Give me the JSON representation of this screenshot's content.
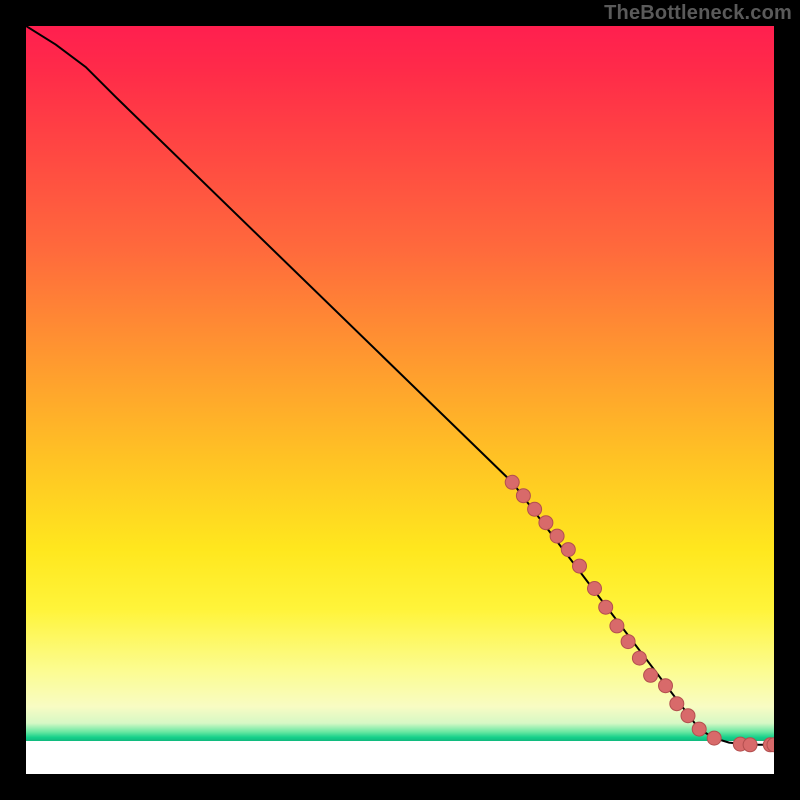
{
  "watermark": "TheBottleneck.com",
  "colors": {
    "frame": "#000000",
    "watermark_text": "#5a5a5a",
    "curve_stroke": "#000000",
    "marker_fill": "#d86a6a",
    "marker_stroke": "#b34f4f",
    "gradient_top": "#ff1f4f",
    "gradient_green": "#16d08b",
    "gradient_bottom": "#ffffff"
  },
  "chart_data": {
    "type": "line",
    "title": "",
    "xlabel": "",
    "ylabel": "",
    "xlim": [
      0,
      100
    ],
    "ylim": [
      0,
      100
    ],
    "grid": false,
    "legend": false,
    "curve": [
      {
        "x": 0,
        "y": 100
      },
      {
        "x": 4,
        "y": 97.5
      },
      {
        "x": 8,
        "y": 94.5
      },
      {
        "x": 12,
        "y": 90.5
      },
      {
        "x": 65,
        "y": 39
      },
      {
        "x": 90,
        "y": 6
      },
      {
        "x": 92,
        "y": 4.8
      },
      {
        "x": 94,
        "y": 4.2
      },
      {
        "x": 96,
        "y": 4.0
      },
      {
        "x": 98,
        "y": 3.9
      },
      {
        "x": 100,
        "y": 3.9
      }
    ],
    "markers": [
      {
        "x": 65.0,
        "y": 39.0
      },
      {
        "x": 66.5,
        "y": 37.2
      },
      {
        "x": 68.0,
        "y": 35.4
      },
      {
        "x": 69.5,
        "y": 33.6
      },
      {
        "x": 71.0,
        "y": 31.8
      },
      {
        "x": 72.5,
        "y": 30.0
      },
      {
        "x": 74.0,
        "y": 27.8
      },
      {
        "x": 76.0,
        "y": 24.8
      },
      {
        "x": 77.5,
        "y": 22.3
      },
      {
        "x": 79.0,
        "y": 19.8
      },
      {
        "x": 80.5,
        "y": 17.7
      },
      {
        "x": 82.0,
        "y": 15.5
      },
      {
        "x": 83.5,
        "y": 13.2
      },
      {
        "x": 85.5,
        "y": 11.8
      },
      {
        "x": 87.0,
        "y": 9.4
      },
      {
        "x": 88.5,
        "y": 7.8
      },
      {
        "x": 90.0,
        "y": 6.0
      },
      {
        "x": 92.0,
        "y": 4.8
      },
      {
        "x": 95.5,
        "y": 4.0
      },
      {
        "x": 96.8,
        "y": 3.9
      },
      {
        "x": 99.5,
        "y": 3.9
      },
      {
        "x": 100,
        "y": 3.9
      }
    ]
  }
}
